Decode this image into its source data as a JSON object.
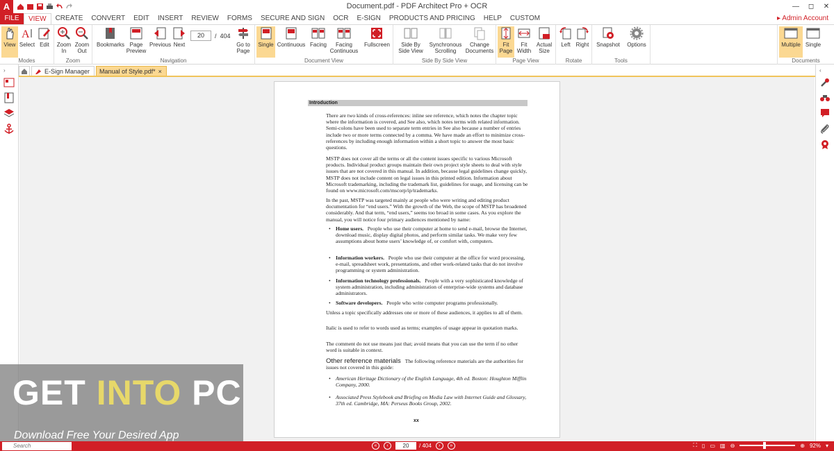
{
  "window": {
    "title": "Document.pdf   -   PDF Architect Pro + OCR",
    "app_logo": "A",
    "restore_label": "◻",
    "close_label": "✕",
    "minimize_label": "—"
  },
  "ribbon_tabs": [
    "FILE",
    "VIEW",
    "CREATE",
    "CONVERT",
    "EDIT",
    "INSERT",
    "REVIEW",
    "FORMS",
    "SECURE AND SIGN",
    "OCR",
    "E-SIGN",
    "PRODUCTS AND PRICING",
    "HELP",
    "CUSTOM"
  ],
  "account_label": "Admin Account",
  "groups": {
    "modes": {
      "label": "Modes",
      "buttons": [
        "View",
        "Select",
        "Edit"
      ]
    },
    "zoom": {
      "label": "Zoom",
      "buttons": [
        "Zoom In",
        "Zoom Out"
      ]
    },
    "navigation": {
      "label": "Navigation",
      "buttons": [
        "Bookmarks",
        "Page Preview",
        "Previous",
        "Next",
        "Go to Page"
      ],
      "current_page": "20",
      "total": "404",
      "sep": "/"
    },
    "document_view": {
      "label": "Document View",
      "buttons": [
        "Single",
        "Continuous",
        "Facing",
        "Facing Continuous",
        "Fullscreen"
      ]
    },
    "side_by_side": {
      "label": "Side By Side View",
      "buttons": [
        "Side By Side View",
        "Synchronous Scrolling",
        "Change Documents"
      ]
    },
    "page_view": {
      "label": "Page View",
      "buttons": [
        "Fit Page",
        "Fit Width",
        "Actual Size"
      ]
    },
    "rotate": {
      "label": "Rotate",
      "buttons": [
        "Left",
        "Right"
      ]
    },
    "tools": {
      "label": "Tools",
      "buttons": [
        "Snapshot",
        "Options"
      ]
    },
    "documents": {
      "label": "Documents",
      "buttons": [
        "Multiple",
        "Single"
      ]
    }
  },
  "doc_tabs": [
    {
      "label": "E-Sign Manager"
    },
    {
      "label": "Manual of Style.pdf*",
      "close": "×"
    }
  ],
  "document": {
    "heading": "Introduction",
    "p1": "There are two kinds of cross-references: inline see reference, which notes the chapter topic where the information is covered, and See also, which notes terms with related information. Semi-colons have been used to separate term entries in See also because a number of entries include two or more terms connected by a comma. We have made an effort to minimize cross-references by including enough information within a short topic to answer the most basic questions.",
    "p2": "MSTP does not cover all the terms or all the content issues specific to various Microsoft products. Individual product groups maintain their own project style sheets to deal with style issues that are not covered in this manual. In addition, because legal guidelines change quickly, MSTP does not include content on legal issues in this printed edition. Information about Microsoft trademarking, including the trademark list, guidelines for usage, and licensing can be found on www.microsoft.com/mscorp/ip/trademarks.",
    "p3": "In the past, MSTP was targeted mainly at people who were writing and editing product documentation for “end users.” With the growth of the Web, the scope of MSTP has broadened considerably. And that term, “end users,” seems too broad in some cases. As you explore the manual, you will notice four primary audiences mentioned by name:",
    "bullets": [
      {
        "term": "Home users.",
        "text": "People who use their computer at home to send e-mail, browse the Internet, download music, display digital photos, and perform similar tasks. We make very few assumptions about home users’ knowledge of, or comfort with, computers."
      },
      {
        "term": "Information workers.",
        "text": "People who use their computer at the office for word processing, e-mail, spreadsheet work, presentations, and other work-related tasks that do not involve programming or system administration."
      },
      {
        "term": "Information technology professionals.",
        "text": "People with a very sophisticated knowledge of system administration, including administration of enterprise-wide systems and database administrators."
      },
      {
        "term": "Software developers.",
        "text": "People who write computer programs professionally."
      }
    ],
    "p4": "Unless a topic specifically addresses one or more of these audiences, it applies to all of them.",
    "p5": "Italic is used to refer to words used as terms; examples of usage appear in quotation marks.",
    "p6": "The comment do not use means just that; avoid means that you can use the term if no other word is suitable in context.",
    "orm_heading": "Other reference materials",
    "orm_text": "The following reference materials are the authorities for issues not covered in this guide:",
    "refs": [
      "American Heritage Dictionary of the English Language, 4th ed. Boston: Houghton Mifflin Company, 2000.",
      "Associated Press Stylebook and Briefing on Media Law with Internet Guide and Glossary, 37th ed. Cambridge, MA: Perseus Books Group, 2002."
    ],
    "page_number": "xx"
  },
  "watermark": {
    "get": "GET ",
    "into": "INTO",
    "pc": " PC",
    "tagline": "Download Free Your Desired App"
  },
  "status": {
    "search_placeholder": "Search",
    "current_page": "20",
    "total": "/ 404",
    "zoom": "92%"
  },
  "colors": {
    "accent": "#d11f26",
    "selected": "#fbd892"
  }
}
